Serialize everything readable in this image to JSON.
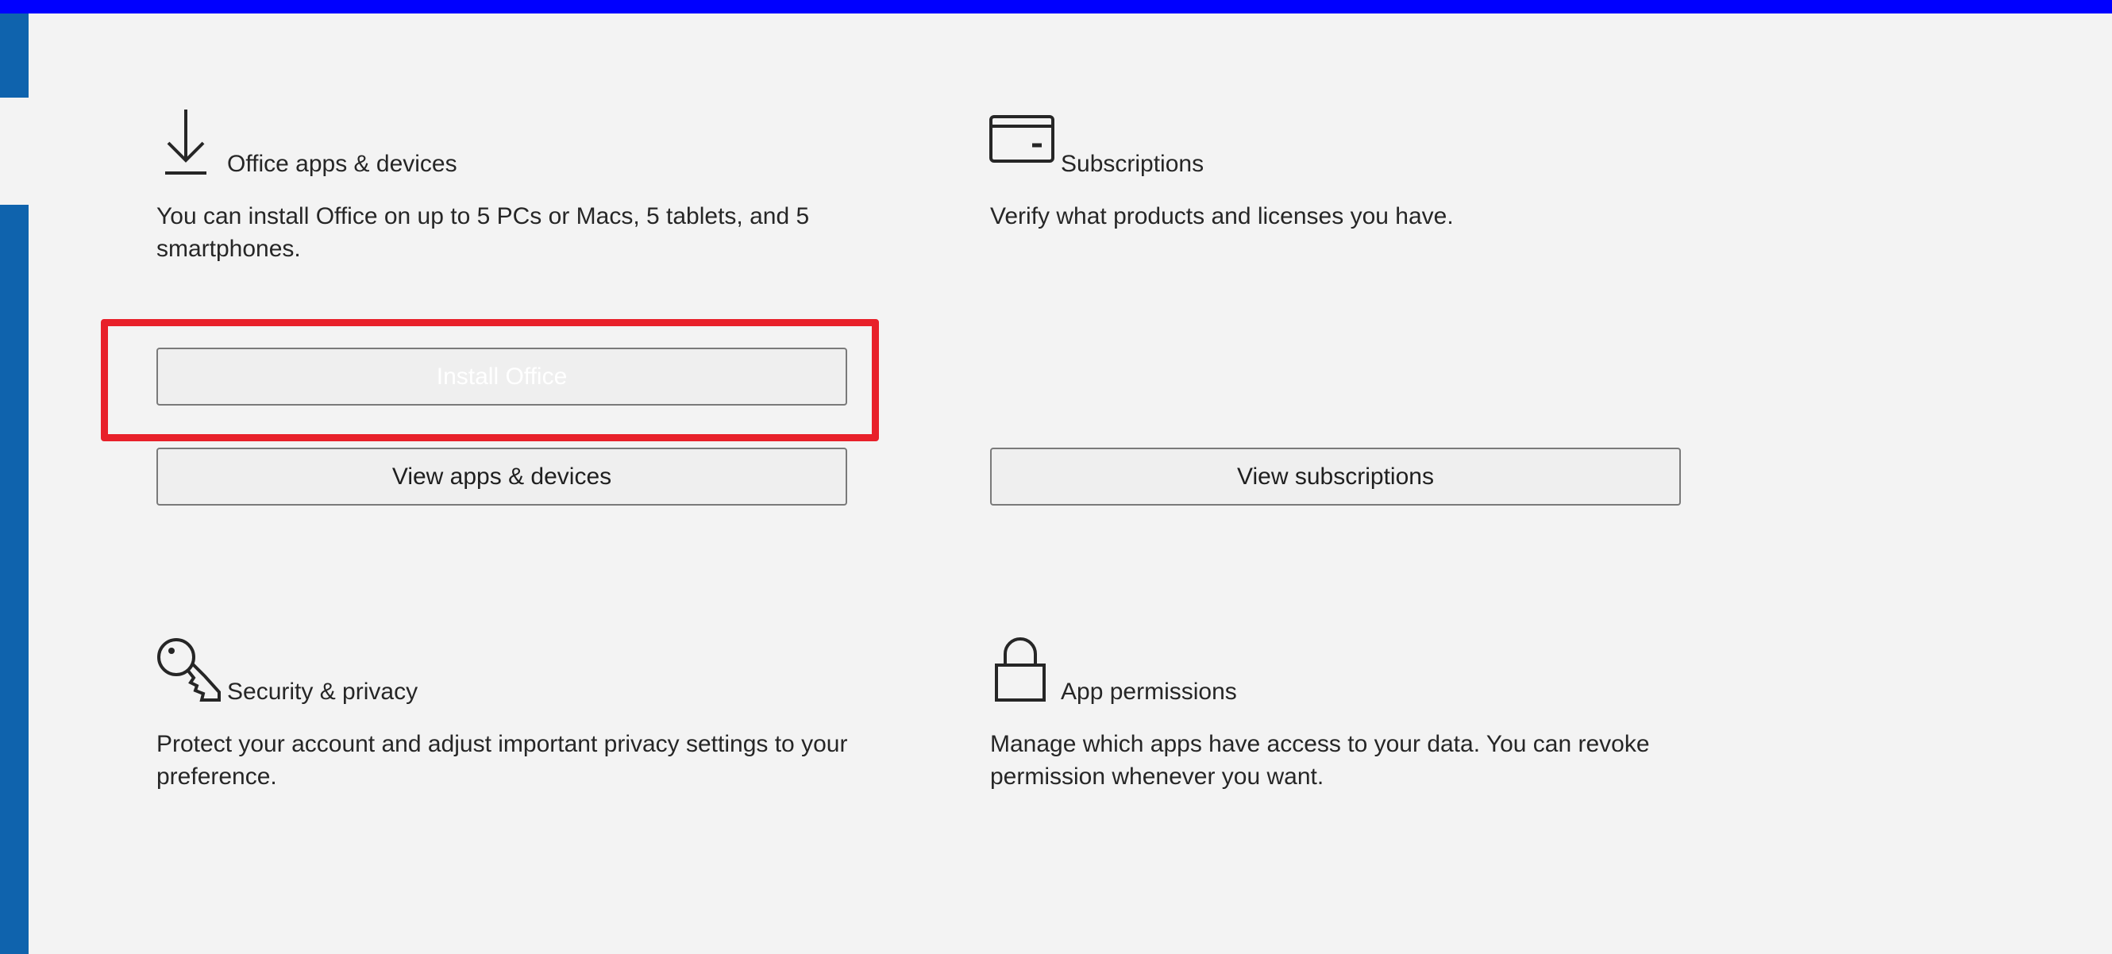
{
  "cards": {
    "office_apps": {
      "icon": "download-icon",
      "title": "Office apps & devices",
      "description": "You can install Office on up to 5 PCs or Macs, 5 tablets, and 5 smartphones.",
      "install_button": "Install Office",
      "view_button": "View apps & devices"
    },
    "subscriptions": {
      "icon": "credit-card-icon",
      "title": "Subscriptions",
      "description": "Verify what products and licenses you have.",
      "view_button": "View subscriptions"
    },
    "security": {
      "icon": "key-icon",
      "title": "Security & privacy",
      "description": "Protect your account and adjust important privacy settings to your preference."
    },
    "app_permissions": {
      "icon": "lock-icon",
      "title": "App permissions",
      "description": "Manage which apps have access to your data. You can revoke permission whenever you want."
    }
  },
  "colors": {
    "top_bar": "#0000ff",
    "left_rail": "#0f63ad",
    "highlight": "#e8202a",
    "background": "#f3f3f3"
  }
}
